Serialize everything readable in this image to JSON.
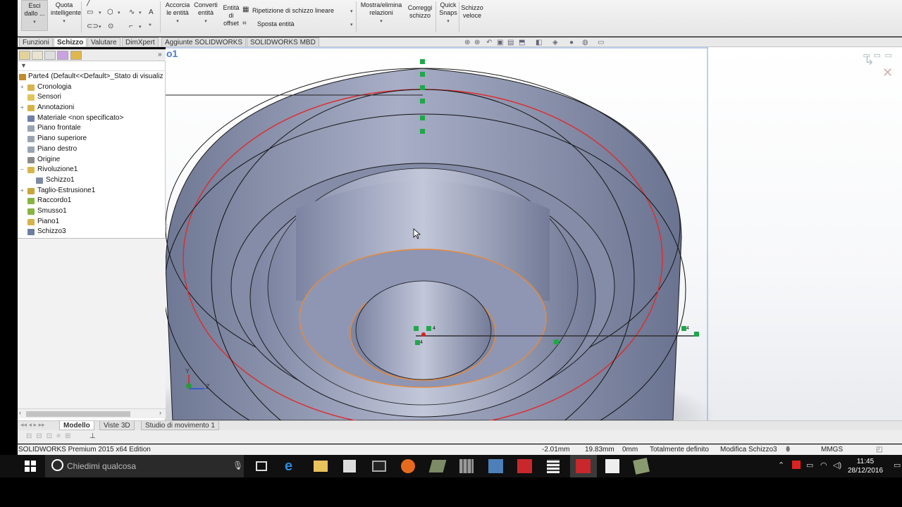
{
  "ribbon": {
    "buttons": [
      {
        "id": "exit-sketch",
        "label": "Esci\ndallo ..."
      },
      {
        "id": "smart-dim",
        "label": "Quota\nintelligente"
      },
      {
        "id": "trim",
        "label": "Accorcia\nle entità"
      },
      {
        "id": "convert",
        "label": "Converti\nentità"
      },
      {
        "id": "offset",
        "label": "Entità\ndi\noffset"
      },
      {
        "id": "linear-pattern",
        "label": "Ripetizione di schizzo lineare"
      },
      {
        "id": "move",
        "label": "Sposta entità"
      },
      {
        "id": "relations",
        "label": "Mostra/elimina\nrelazioni"
      },
      {
        "id": "repair",
        "label": "Correggi\nschizzo"
      },
      {
        "id": "snaps",
        "label": "Quick\nSnaps"
      },
      {
        "id": "rapid",
        "label": "Schizzo\nveloce"
      }
    ]
  },
  "command_tabs": [
    "Funzioni",
    "Schizzo",
    "Valutare",
    "DimXpert",
    "Aggiunte SOLIDWORKS",
    "SOLIDWORKS MBD"
  ],
  "active_command_tab": "Schizzo",
  "viewport": {
    "sketch_label": "o1",
    "axis_y": "Y",
    "axis_z": "Z",
    "relation_tags": [
      "4",
      "4",
      "4"
    ]
  },
  "feature_tree": {
    "root": "Parte4  (Default<<Default>_Stato di visualiz",
    "items": [
      {
        "label": "Cronologia",
        "expand": "+",
        "icon": "history-icon",
        "indent": 1,
        "color": "#d7b44e"
      },
      {
        "label": "Sensori",
        "expand": "",
        "icon": "sensor-icon",
        "indent": 1,
        "color": "#e1c45a"
      },
      {
        "label": "Annotazioni",
        "expand": "+",
        "icon": "annotation-icon",
        "indent": 1,
        "color": "#d6b349"
      },
      {
        "label": "Materiale <non specificato>",
        "expand": "",
        "icon": "material-icon",
        "indent": 1,
        "color": "#6e7fa8"
      },
      {
        "label": "Piano frontale",
        "expand": "",
        "icon": "plane-icon",
        "indent": 1,
        "color": "#9aa3b0"
      },
      {
        "label": "Piano superiore",
        "expand": "",
        "icon": "plane-icon",
        "indent": 1,
        "color": "#9aa3b0"
      },
      {
        "label": "Piano destro",
        "expand": "",
        "icon": "plane-icon",
        "indent": 1,
        "color": "#9aa3b0"
      },
      {
        "label": "Origine",
        "expand": "",
        "icon": "origin-icon",
        "indent": 1,
        "color": "#8b8b8b"
      },
      {
        "label": "Rivoluzione1",
        "expand": "−",
        "icon": "revolve-icon",
        "indent": 1,
        "color": "#d9b64a"
      },
      {
        "label": "Schizzo1",
        "expand": "",
        "icon": "sketch-icon",
        "indent": 2,
        "color": "#7d8aa3"
      },
      {
        "label": "Taglio-Estrusione1",
        "expand": "+",
        "icon": "cut-extrude-icon",
        "indent": 1,
        "color": "#c9a63d"
      },
      {
        "label": "Raccordo1",
        "expand": "",
        "icon": "fillet-icon",
        "indent": 1,
        "color": "#88b443"
      },
      {
        "label": "Smusso1",
        "expand": "",
        "icon": "chamfer-icon",
        "indent": 1,
        "color": "#88b443"
      },
      {
        "label": "Piano1",
        "expand": "",
        "icon": "plane-icon",
        "indent": 1,
        "color": "#d6b349"
      },
      {
        "label": "Schizzo3",
        "expand": "",
        "icon": "sketch-icon",
        "indent": 1,
        "color": "#6b7fa0"
      }
    ]
  },
  "bottom_tabs": [
    "Modello",
    "Viste 3D",
    "Studio di movimento 1"
  ],
  "active_bottom_tab": "Modello",
  "status": {
    "app": "SOLIDWORKS Premium 2015 x64 Edition",
    "x": "-2.01mm",
    "y": "19.83mm",
    "z": "0mm",
    "state": "Totalmente definito",
    "editing": "Modifica Schizzo3",
    "units": "MMGS"
  },
  "taskbar": {
    "search_placeholder": "Chiedimi qualcosa",
    "time": "11:45",
    "date": "28/12/2016"
  },
  "colors": {
    "part_body": "#8e96b4",
    "sketch_red": "#e02a2a",
    "sketch_orange": "#e88a3a",
    "relation_green": "#1fa84a"
  }
}
